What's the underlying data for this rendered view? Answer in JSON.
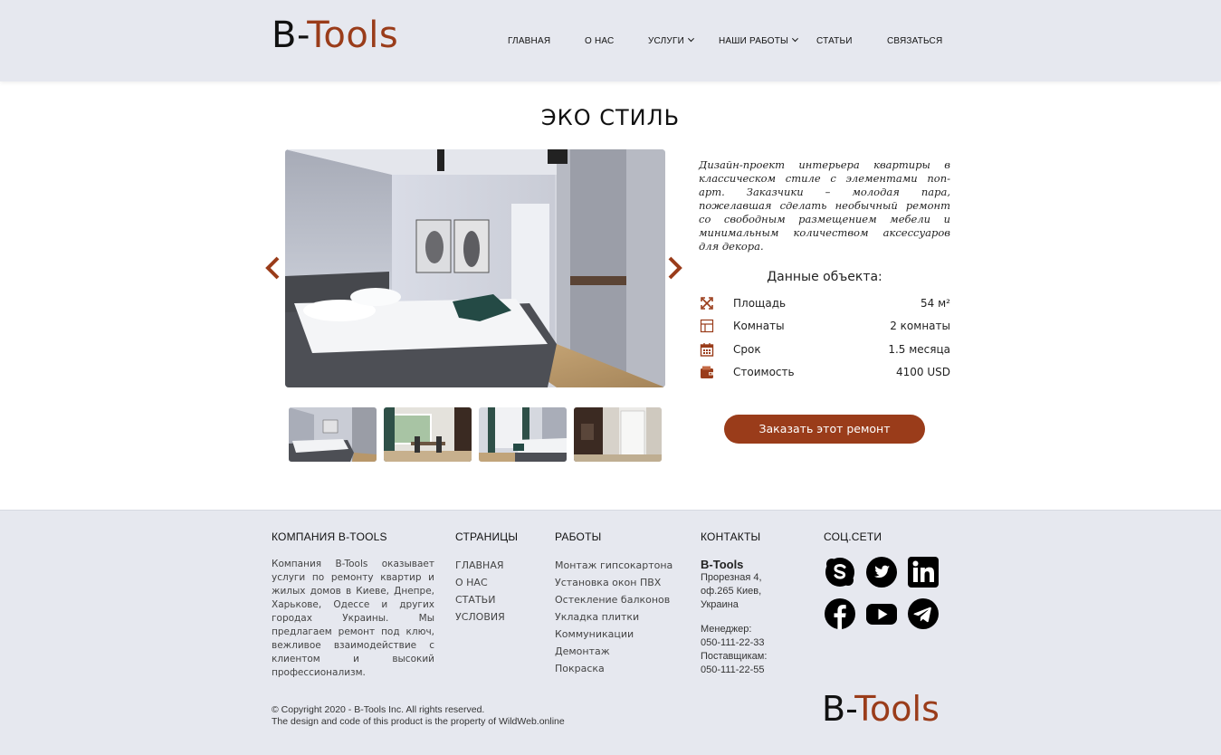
{
  "header": {
    "logo_part1": "B-",
    "logo_part2": "Tools",
    "nav": [
      {
        "label": "ГЛАВНАЯ"
      },
      {
        "label": "О НАС"
      },
      {
        "label": "УСЛУГИ"
      },
      {
        "label": "НАШИ РАБОТЫ"
      },
      {
        "label": "СТАТЬИ"
      },
      {
        "label": "СВЯЗАТЬСЯ"
      }
    ]
  },
  "project": {
    "title": "ЭКО СТИЛЬ",
    "description": "Дизайн-проект интерьера квартиры в классическом стиле с элементами поп-арт. Заказчики – молодая пара, пожелавшая сделать необычный ремонт со свободным размещением мебели и минимальным количеством аксессуаров для декора.",
    "details_title": "Данные объекта:",
    "details": [
      {
        "icon": "expand-icon",
        "label": "Площадь",
        "value": "54 м²"
      },
      {
        "icon": "floorplan-icon",
        "label": "Комнаты",
        "value": "2 комнаты"
      },
      {
        "icon": "calendar-icon",
        "label": "Срок",
        "value": "1.5 месяца"
      },
      {
        "icon": "wallet-icon",
        "label": "Стоимость",
        "value": "4100 USD"
      }
    ],
    "order_button": "Заказать этот ремонт",
    "accent_color": "#9a3c1a"
  },
  "footer": {
    "company": {
      "heading": "КОМПАНИЯ B-TOOLS",
      "text": "Компания B-Tools оказывает услуги по ремонту квартир и жилых домов в Киеве, Днепре, Харькове, Одессе и других городах Украины. Мы предлагаем ремонт под ключ, вежливое взаимодействие с клиентом и высокий профессионализм."
    },
    "pages": {
      "heading": "СТРАНИЦЫ",
      "links": [
        "ГЛАВНАЯ",
        "О НАС",
        "СТАТЬИ",
        "УСЛОВИЯ"
      ]
    },
    "works": {
      "heading": "РАБОТЫ",
      "links": [
        "Монтаж гипсокартона",
        "Установка окон ПВХ",
        "Остекление балконов",
        "Укладка плитки",
        "Коммуникации",
        "Демонтаж",
        "Покраска"
      ]
    },
    "contacts": {
      "heading": "КОНТАКТЫ",
      "company": "B-Tools",
      "address": [
        "Прорезная 4,",
        "оф.265 Киев,",
        "Украина"
      ],
      "manager_label": "Менеджер:",
      "manager_phone": "050-111-22-33",
      "supplier_label": "Поставщикам:",
      "supplier_phone": "050-111-22-55"
    },
    "social": {
      "heading": "СОЦ.СЕТИ",
      "icons": [
        "skype-icon",
        "twitter-icon",
        "linkedin-icon",
        "facebook-icon",
        "youtube-icon",
        "telegram-icon"
      ]
    },
    "copyright": "© Copyright 2020 - B-Tools Inc. All rights reserved.",
    "property_text": "The design and code of this product is the property of WildWeb.online",
    "logo_part1": "B-",
    "logo_part2": "Tools"
  }
}
